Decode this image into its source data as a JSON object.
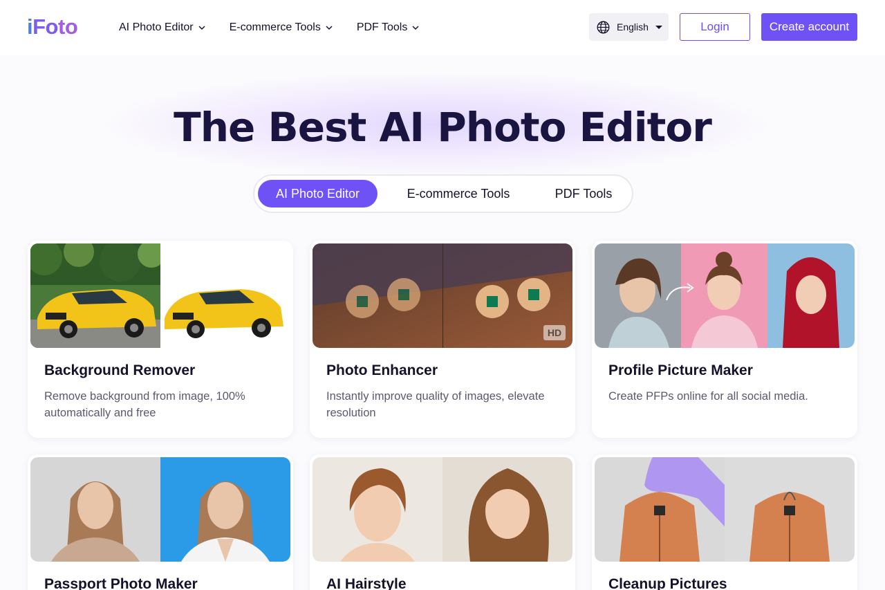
{
  "header": {
    "logo": {
      "p1": "i",
      "p2": "Fo",
      "p3": "to"
    },
    "nav": [
      {
        "label": "AI Photo Editor"
      },
      {
        "label": "E-commerce Tools"
      },
      {
        "label": "PDF Tools"
      }
    ],
    "language": "English",
    "login_label": "Login",
    "create_label": "Create account"
  },
  "hero": {
    "title": "The Best AI Photo Editor",
    "tabs": [
      {
        "label": "AI Photo Editor",
        "active": true
      },
      {
        "label": "E-commerce Tools",
        "active": false
      },
      {
        "label": "PDF Tools",
        "active": false
      }
    ]
  },
  "cards": [
    {
      "title": "Background Remover",
      "desc": "Remove background from image, 100% automatically and free",
      "image": "car-before-after"
    },
    {
      "title": "Photo Enhancer",
      "desc": "Instantly improve quality of images, elevate resolution",
      "image": "earrings-hd",
      "badge": "HD"
    },
    {
      "title": "Profile Picture Maker",
      "desc": "Create PFPs online for all social media.",
      "image": "portraits-trio"
    },
    {
      "title": "Passport Photo Maker",
      "desc": "",
      "image": "passport-woman"
    },
    {
      "title": "AI Hairstyle",
      "desc": "",
      "image": "hairstyle-woman"
    },
    {
      "title": "Cleanup Pictures",
      "desc": "",
      "image": "jacket-cleanup"
    }
  ],
  "colors": {
    "accent": "#6f52f5",
    "title": "#1a1540",
    "text": "#14112b",
    "muted": "#5b5870"
  }
}
